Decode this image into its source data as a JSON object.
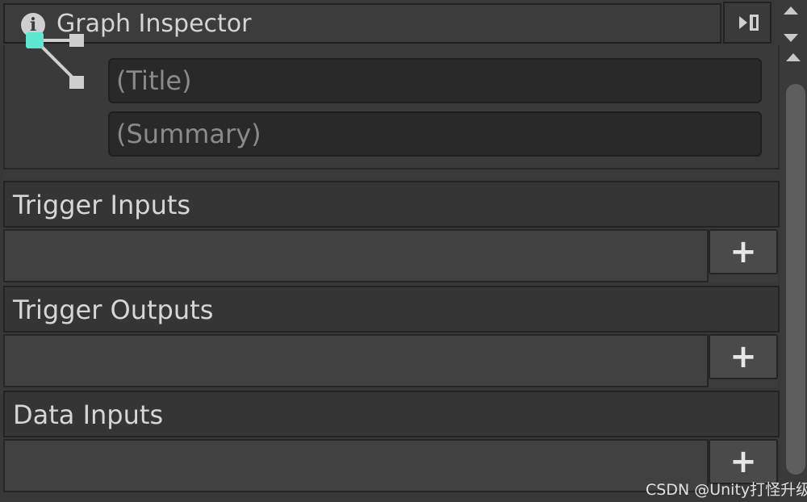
{
  "header": {
    "title": "Graph Inspector",
    "info_icon": "info-icon",
    "info_glyph": "i",
    "dock_icon": "dock-panel-icon"
  },
  "graph": {
    "icon": "graph-node-icon",
    "accent_color": "#5fe6d2",
    "title_placeholder": "(Title)",
    "summary_placeholder": "(Summary)"
  },
  "sections": [
    {
      "label": "Trigger Inputs",
      "add_label": "+"
    },
    {
      "label": "Trigger Outputs",
      "add_label": "+"
    },
    {
      "label": "Data Inputs",
      "add_label": "+"
    }
  ],
  "watermark": "CSDN @Unity打怪升级"
}
